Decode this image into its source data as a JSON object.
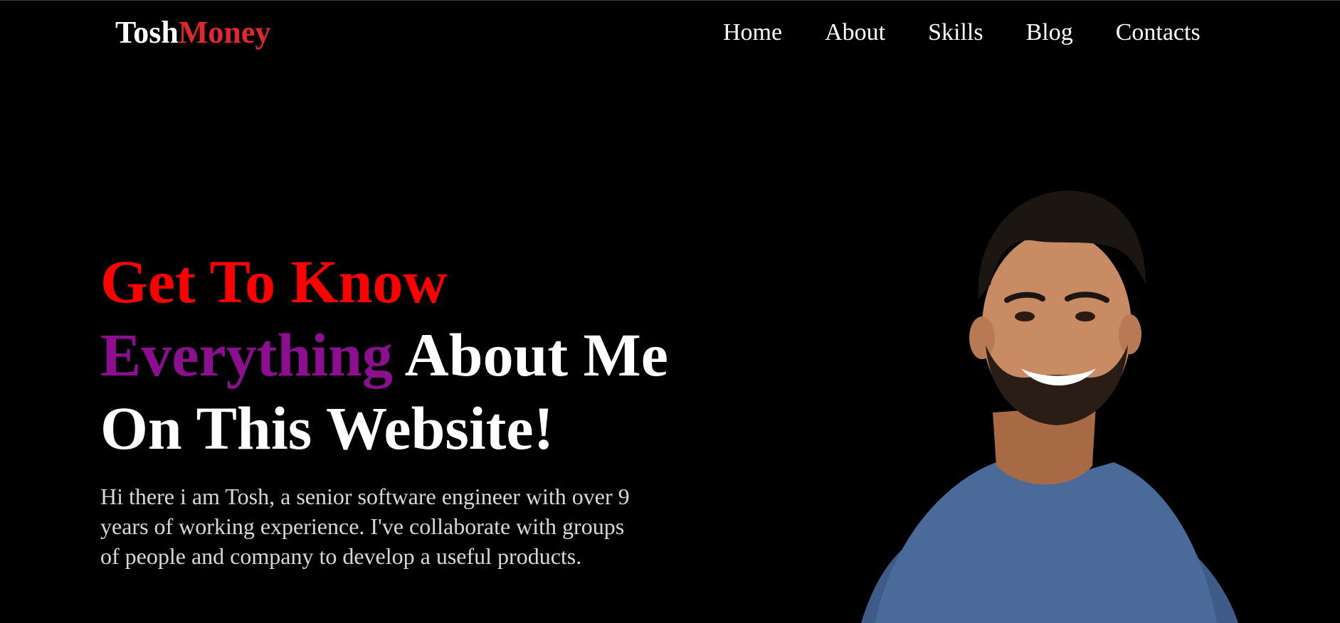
{
  "brand": {
    "first": "Tosh",
    "second": "Money",
    "first_color": "#ffffff",
    "second_color": "#e0282e"
  },
  "nav": {
    "items": [
      "Home",
      "About",
      "Skills",
      "Blog",
      "Contacts"
    ]
  },
  "hero": {
    "line1": "Get To Know",
    "line2_highlight": "Everything",
    "line2_rest": "About Me",
    "line3": "On This Website!",
    "colors": {
      "accent_red": "#ff0000",
      "accent_purple": "#8b0f8f",
      "text": "#ffffff"
    },
    "intro": "Hi there i am Tosh, a senior software engineer with over 9 years of working experience. I've collaborate with groups of people and company to develop a useful products."
  },
  "portrait": {
    "icon": "person-photo",
    "shirt_color": "#4a6a9a",
    "skin_color": "#c98b64",
    "hair_color": "#1c1612"
  }
}
